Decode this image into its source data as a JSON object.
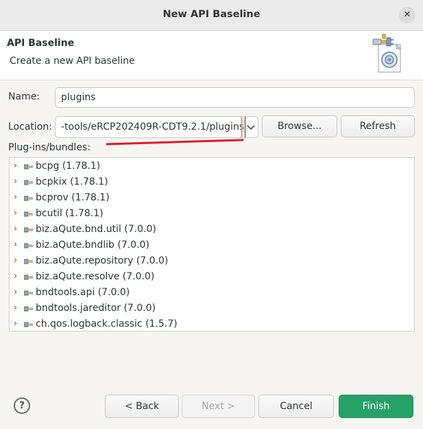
{
  "window": {
    "title": "New API Baseline",
    "close_glyph": "✕"
  },
  "banner": {
    "heading": "API Baseline",
    "description": "Create a new API baseline",
    "icon": "api-baseline-wizard-icon"
  },
  "form": {
    "name_label": "Name:",
    "name_value": "plugins",
    "location_label": "Location:",
    "location_value": "-tools/eRCP202409R-CDT9.2.1/plugins",
    "browse_label": "Browse...",
    "refresh_label": "Refresh",
    "bundles_label": "Plug-ins/bundles:"
  },
  "bundles": [
    "bcpg (1.78.1)",
    "bcpkix (1.78.1)",
    "bcprov (1.78.1)",
    "bcutil (1.78.1)",
    "biz.aQute.bnd.util (7.0.0)",
    "biz.aQute.bndlib (7.0.0)",
    "biz.aQute.repository (7.0.0)",
    "biz.aQute.resolve (7.0.0)",
    "bndtools.api (7.0.0)",
    "bndtools.jareditor (7.0.0)",
    "ch.qos.logback.classic (1.5.7)"
  ],
  "buttons": {
    "back": "< Back",
    "next": "Next >",
    "cancel": "Cancel",
    "finish": "Finish"
  },
  "colors": {
    "finish": "#26a269",
    "annotation": "#e01b24",
    "location_border": "#e8775f"
  }
}
